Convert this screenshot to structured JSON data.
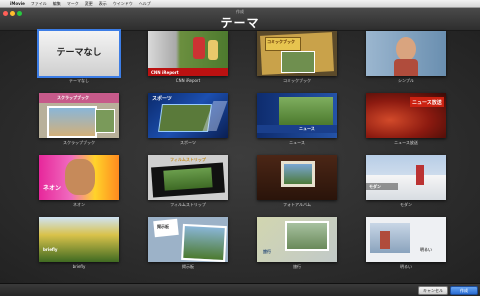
{
  "menubar": {
    "apple": "",
    "items": [
      "iMovie",
      "ファイル",
      "編集",
      "マーク",
      "変更",
      "表示",
      "ウインドウ",
      "ヘルプ"
    ]
  },
  "window": {
    "small_title": "作成",
    "title": "テーマ"
  },
  "themes": [
    {
      "label": "テーマなし",
      "overlay": "テーマなし"
    },
    {
      "label": "CNN iReport",
      "overlay": "CNN iReport"
    },
    {
      "label": "コミックブック",
      "overlay": "コミックブック"
    },
    {
      "label": "シンプル",
      "overlay": ""
    },
    {
      "label": "スクラップブック",
      "overlay": "スクラップブック"
    },
    {
      "label": "スポーツ",
      "overlay": "スポーツ"
    },
    {
      "label": "ニュース",
      "overlay": "ニュース"
    },
    {
      "label": "ニュース放送",
      "overlay": "ニュース放送"
    },
    {
      "label": "ネオン",
      "overlay": "ネオン"
    },
    {
      "label": "フィルムストリップ",
      "overlay": "フィルムストリップ"
    },
    {
      "label": "フォトアルバム",
      "overlay": ""
    },
    {
      "label": "モダン",
      "overlay": "モダン"
    },
    {
      "label": "briefly",
      "overlay": "briefly"
    },
    {
      "label": "掲示板",
      "overlay": "掲示板"
    },
    {
      "label": "旅行",
      "overlay": "旅行"
    },
    {
      "label": "明るい",
      "overlay": "明るい"
    }
  ],
  "buttons": {
    "cancel": "キャンセル",
    "create": "作成"
  },
  "colors": {
    "selection": "#3c7de6",
    "background": "#2b2b2b"
  }
}
